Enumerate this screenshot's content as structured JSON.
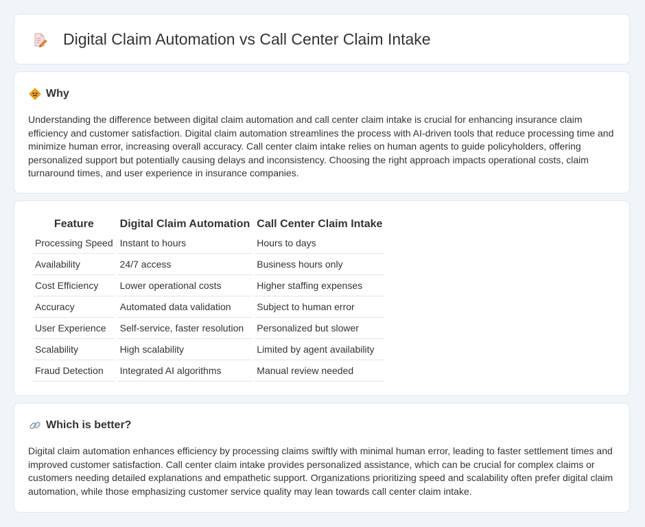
{
  "header": {
    "title": "Digital Claim Automation vs Call Center Claim Intake",
    "icon": "document-pencil-icon"
  },
  "why": {
    "heading": "Why",
    "icon": "diamond-sign-icon",
    "text": "Understanding the difference between digital claim automation and call center claim intake is crucial for enhancing insurance claim efficiency and customer satisfaction. Digital claim automation streamlines the process with AI-driven tools that reduce processing time and minimize human error, increasing overall accuracy. Call center claim intake relies on human agents to guide policyholders, offering personalized support but potentially causing delays and inconsistency. Choosing the right approach impacts operational costs, claim turnaround times, and user experience in insurance companies."
  },
  "comparison": {
    "headers": [
      "Feature",
      "Digital Claim Automation",
      "Call Center Claim Intake"
    ],
    "rows": [
      [
        "Processing Speed",
        "Instant to hours",
        "Hours to days"
      ],
      [
        "Availability",
        "24/7 access",
        "Business hours only"
      ],
      [
        "Cost Efficiency",
        "Lower operational costs",
        "Higher staffing expenses"
      ],
      [
        "Accuracy",
        "Automated data validation",
        "Subject to human error"
      ],
      [
        "User Experience",
        "Self-service, faster resolution",
        "Personalized but slower"
      ],
      [
        "Scalability",
        "High scalability",
        "Limited by agent availability"
      ],
      [
        "Fraud Detection",
        "Integrated AI algorithms",
        "Manual review needed"
      ]
    ]
  },
  "better": {
    "heading": "Which is better?",
    "icon": "link-icon",
    "text": "Digital claim automation enhances efficiency by processing claims swiftly with minimal human error, leading to faster settlement times and improved customer satisfaction. Call center claim intake provides personalized assistance, which can be crucial for complex claims or customers needing detailed explanations and empathetic support. Organizations prioritizing speed and scalability often prefer digital claim automation, while those emphasizing customer service quality may lean towards call center claim intake."
  }
}
